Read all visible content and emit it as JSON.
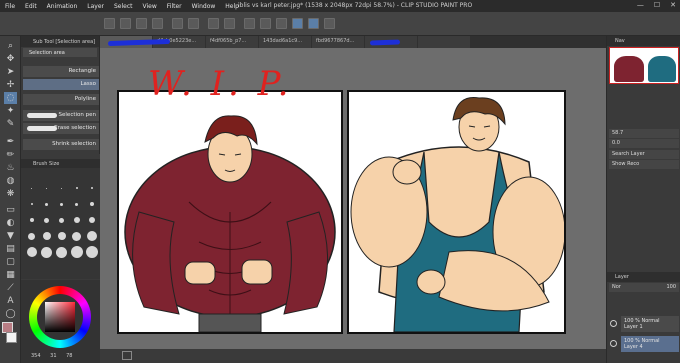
{
  "window": {
    "title": "iblis vs karl peter.jpg* (1538 x 2048px 72dpi 58.7%)  - CLIP STUDIO PAINT PRO",
    "minimize": "—",
    "maximize": "☐",
    "close": "✕"
  },
  "menu": [
    "File",
    "Edit",
    "Animation",
    "Layer",
    "Select",
    "View",
    "Filter",
    "Window",
    "Help"
  ],
  "tabs": [
    {
      "label": "",
      "active": true
    },
    {
      "label": "d4cb0e5223e...",
      "active": false
    },
    {
      "label": "f4df065b_p7...",
      "active": false
    },
    {
      "label": "143dad6a1c9...",
      "active": false
    },
    {
      "label": "fbd9677867d...",
      "active": false
    },
    {
      "label": "",
      "active": false
    },
    {
      "label": "",
      "active": false
    }
  ],
  "subtool": {
    "header": "Sub Tool [Selection area]",
    "tab": "Selection area",
    "items": [
      "Rectangle",
      "Lasso",
      "Polyline",
      "Selection pen",
      "Erase selection",
      "Shrink selection"
    ],
    "selected": "Lasso"
  },
  "brushsize": {
    "header": "Brush Size",
    "sizes": [
      "0.7",
      "1",
      "1.5",
      "2",
      "2.5",
      "3",
      "4",
      "5",
      "6",
      "7",
      "8",
      "10",
      "12",
      "15",
      "17",
      "20",
      "25",
      "30",
      "40",
      "50",
      "60",
      "70",
      "80",
      "100",
      "120"
    ]
  },
  "color": {
    "main": "#b97d84",
    "sub": "#f4f4f4",
    "h_value": "354",
    "s_value": "31",
    "v_value": "78"
  },
  "canvas": {
    "annotation": "W. I. P."
  },
  "navigator": {
    "header": "Nav",
    "zoom": "58.7",
    "angle": "0.0"
  },
  "property_panels": {
    "search_layer": "Search Layer",
    "blend_mode": "Show Reco"
  },
  "layers": {
    "header": "Layer",
    "opacity": "100",
    "mode": "Nor",
    "rows": [
      {
        "meta": "100 % Normal",
        "name": "Layer 1",
        "selected": false
      },
      {
        "meta": "100 % Normal",
        "name": "Layer 4",
        "selected": true
      }
    ]
  },
  "colors": {
    "app_bg": "#3a3a3a",
    "accent_selection": "#5b7fa8",
    "red_shirt": "#7e2330",
    "teal_tank": "#1f6c80",
    "skin": "#f6d2aa",
    "wip_red": "#e0221f",
    "scribble_blue": "#1d2fd8"
  }
}
